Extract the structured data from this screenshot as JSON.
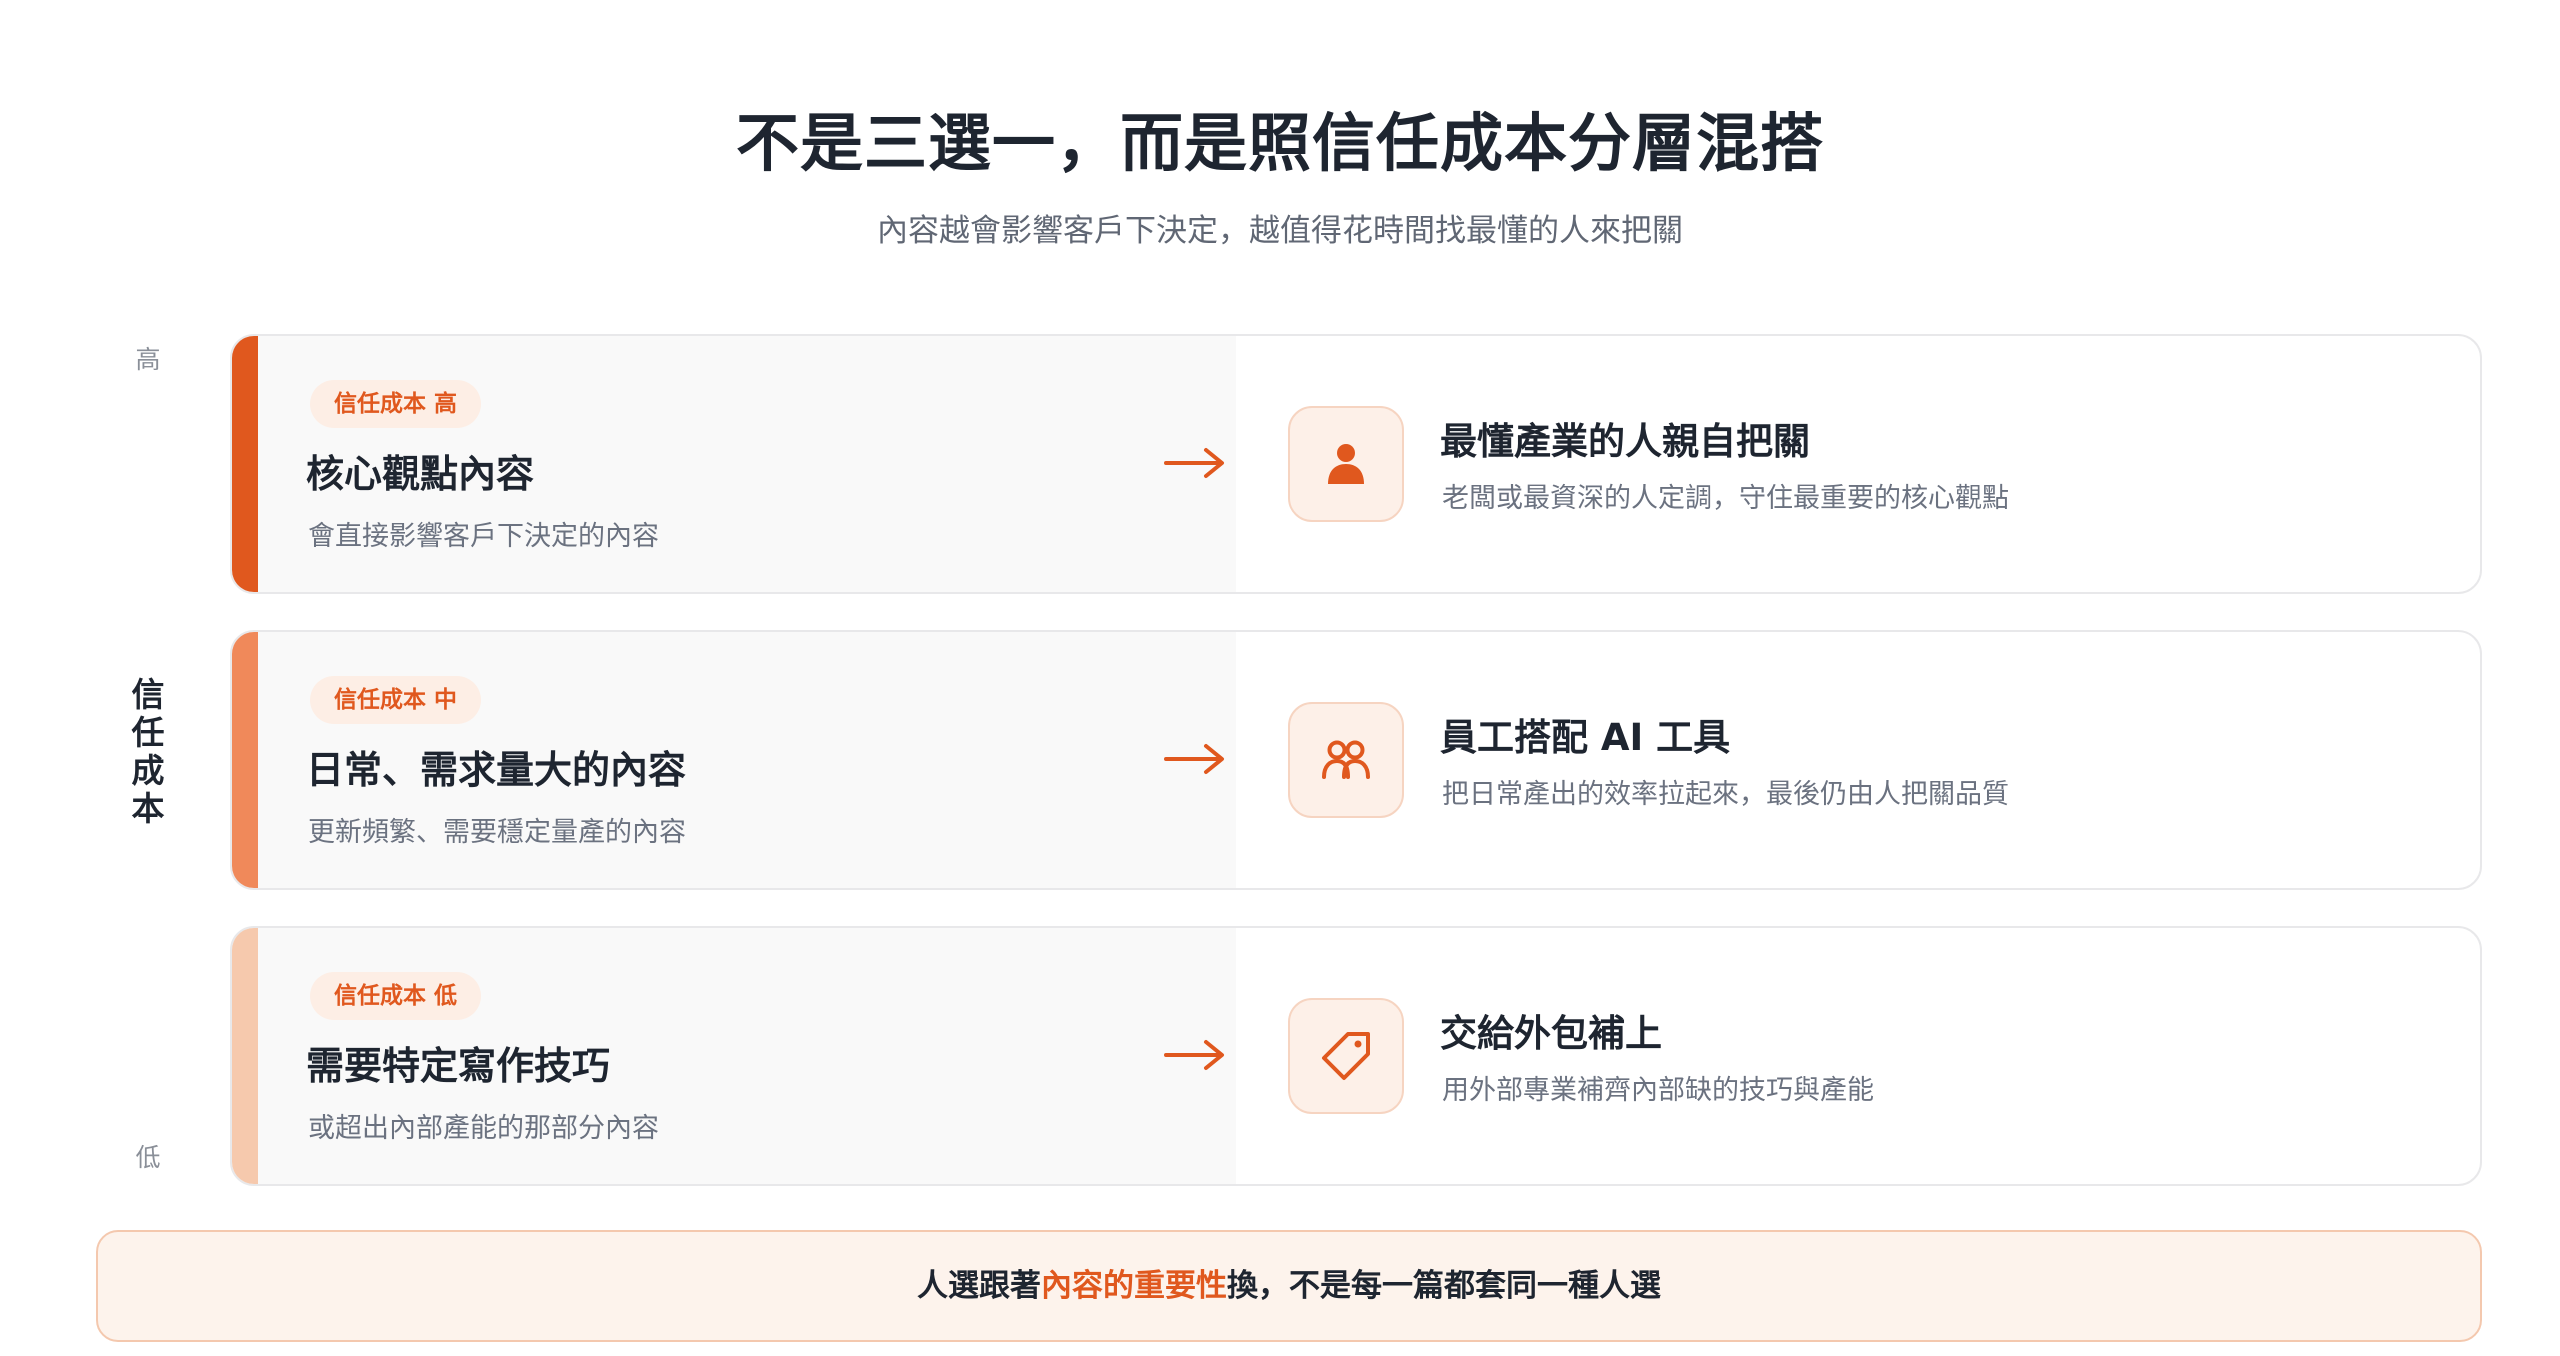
{
  "header": {
    "title": "不是三選一，而是照信任成本分層混搭",
    "subtitle": "內容越會影響客戶下決定，越值得花時間找最懂的人來把關"
  },
  "axis": {
    "high": "高",
    "low": "低",
    "label": "信任成本"
  },
  "rows": [
    {
      "badge": "信任成本 高",
      "title": "核心觀點內容",
      "desc": "會直接影響客戶下決定的內容",
      "right_title": "最懂產業的人親自把關",
      "right_desc": "老闆或最資深的人定調，守住最重要的核心觀點",
      "icon": "person-icon",
      "bar_color": "#e0581e"
    },
    {
      "badge": "信任成本 中",
      "title": "日常、需求量大的內容",
      "desc": "更新頻繁、需要穩定量產的內容",
      "right_title": "員工搭配 AI 工具",
      "right_desc": "把日常產出的效率拉起來，最後仍由人把關品質",
      "icon": "people-icon",
      "bar_color": "#f0895a"
    },
    {
      "badge": "信任成本 低",
      "title": "需要特定寫作技巧",
      "desc": "或超出內部產能的那部分內容",
      "right_title": "交給外包補上",
      "right_desc": "用外部專業補齊內部缺的技巧與產能",
      "icon": "tag-icon",
      "bar_color": "#f6c9ad"
    }
  ],
  "footer": {
    "before": "人選跟著",
    "highlight": "內容的重要性",
    "after": "換，不是每一篇都套同一種人選"
  },
  "colors": {
    "accent": "#e0581e"
  }
}
